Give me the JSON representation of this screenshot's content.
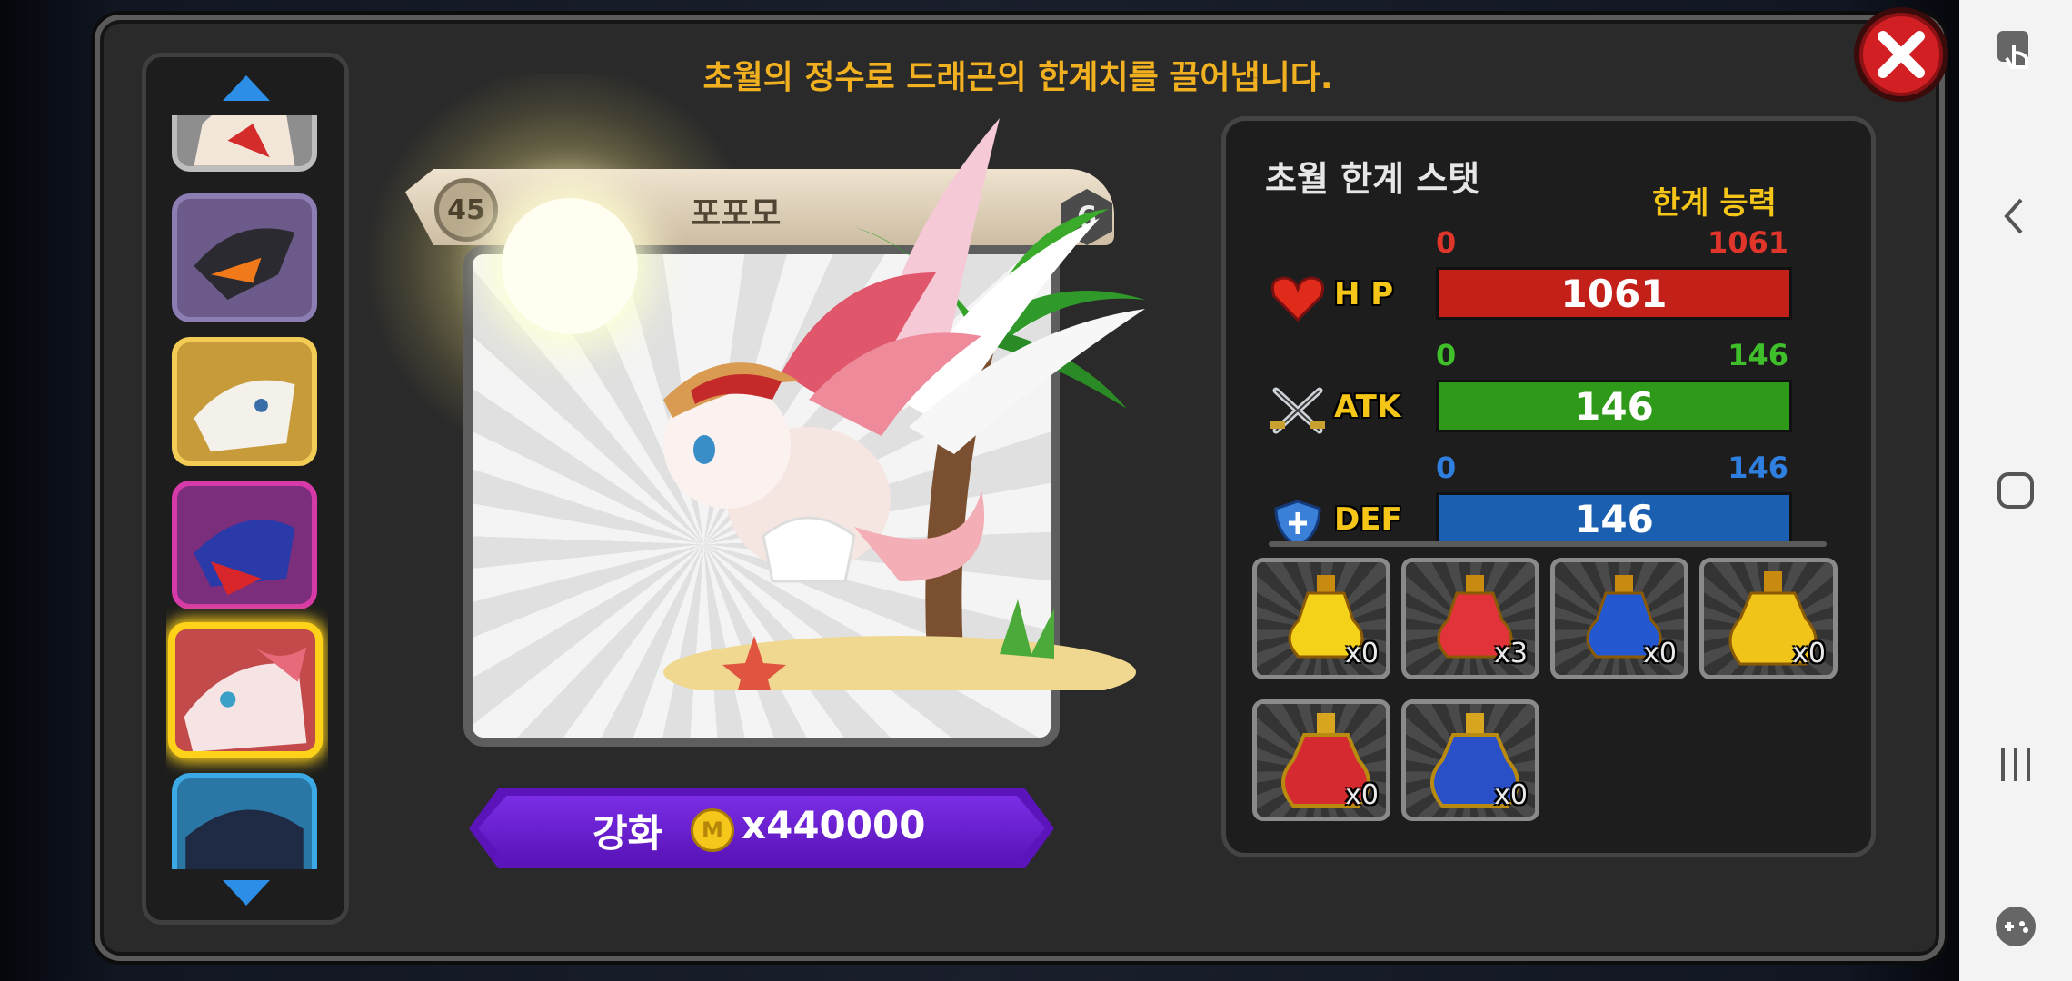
{
  "header": {
    "message": "초월의 정수로 드래곤의 한계치를 끌어냅니다."
  },
  "dragon": {
    "level": "45",
    "name": "포포모",
    "grade": "6"
  },
  "upgrade": {
    "label": "강화",
    "coin_symbol": "M",
    "cost": "x440000"
  },
  "stats": {
    "title": "초월 한계 스탯",
    "subtitle": "한계 능력",
    "rows": [
      {
        "name": "H P",
        "icon": "heart-icon",
        "min": "0",
        "max": "1061",
        "value": "1061",
        "fill": 1.0,
        "color": "#c4201a",
        "range_color": "#e0352b"
      },
      {
        "name": "ATK",
        "icon": "crossed-swords-icon",
        "min": "0",
        "max": "146",
        "value": "146",
        "fill": 1.0,
        "color": "#2f9a1a",
        "range_color": "#3fbf2a"
      },
      {
        "name": "DEF",
        "icon": "shield-icon",
        "min": "0",
        "max": "146",
        "value": "146",
        "fill": 1.0,
        "color": "#1a5fb0",
        "range_color": "#2f7fe0"
      }
    ]
  },
  "potions": [
    {
      "name": "yellow-potion",
      "qty": "x0",
      "color": "#f5d21a"
    },
    {
      "name": "red-potion",
      "qty": "x3",
      "color": "#e2333a"
    },
    {
      "name": "blue-potion",
      "qty": "x0",
      "color": "#2458d0"
    },
    {
      "name": "gold-potion",
      "qty": "x0",
      "color": "#f0c418"
    },
    {
      "name": "big-red-potion",
      "qty": "x0",
      "color": "#d42a30"
    },
    {
      "name": "big-blue-potion",
      "qty": "x0",
      "color": "#2a50c8"
    }
  ],
  "nav": [
    "touch-icon",
    "back-icon",
    "home-icon",
    "recents-icon",
    "game-tools-icon"
  ]
}
